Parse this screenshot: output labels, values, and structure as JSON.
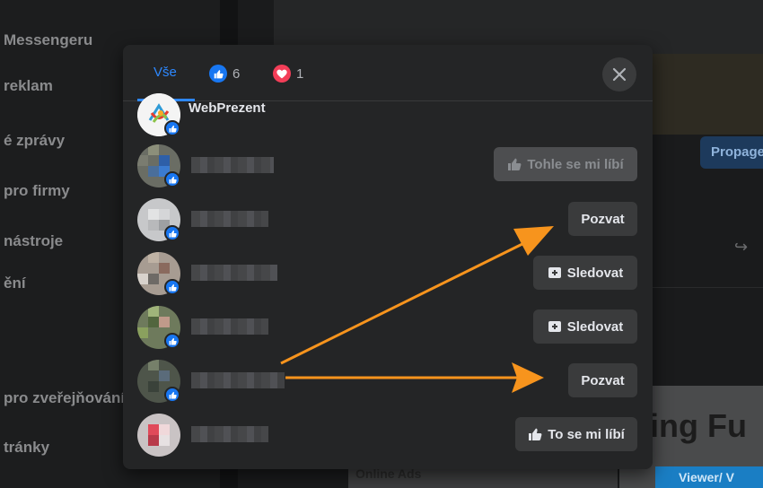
{
  "background": {
    "sidebar_items": [
      "Messengeru",
      "reklam",
      "é zprávy",
      "pro firmy",
      "nástroje",
      "ění",
      "pro zveřejňování",
      "tránky"
    ],
    "promote_label": "Propagе",
    "ad_headline": "ing Fu",
    "ad_strip": "Viewer/ V",
    "online_ads": "Online Ads"
  },
  "modal": {
    "tabs": {
      "all_label": "Vše",
      "like_count": "6",
      "love_count": "1"
    },
    "people": [
      {
        "name": "WebPrezent",
        "blurred": false,
        "action": null
      },
      {
        "name": "",
        "blurred": true,
        "action": "Tohle se mi líbí",
        "action_icon": "thumbs-up-icon",
        "action_disabled": true
      },
      {
        "name": "",
        "blurred": true,
        "action": "Pozvat",
        "action_icon": null,
        "action_disabled": false
      },
      {
        "name": "",
        "blurred": true,
        "action": "Sledovat",
        "action_icon": "follow-icon",
        "action_disabled": false
      },
      {
        "name": "",
        "blurred": true,
        "action": "Sledovat",
        "action_icon": "follow-icon",
        "action_disabled": false
      },
      {
        "name": "",
        "blurred": true,
        "action": "Pozvat",
        "action_icon": null,
        "action_disabled": false
      },
      {
        "name": "",
        "blurred": true,
        "action": "To se mi líbí",
        "action_icon": "thumbs-up-icon",
        "action_disabled": false
      }
    ]
  },
  "colors": {
    "accent": "#2d88ff",
    "like_blue": "#1877f2",
    "love_red": "#f33e58",
    "annotation_arrow": "#f7941d"
  }
}
